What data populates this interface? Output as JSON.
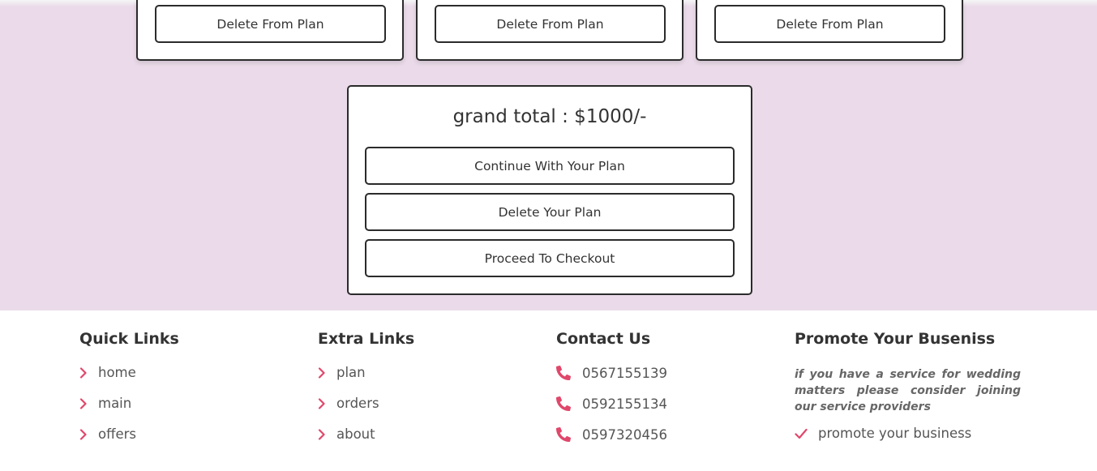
{
  "plan": {
    "cards": [
      {
        "delete_label": "Delete From Plan"
      },
      {
        "delete_label": "Delete From Plan"
      },
      {
        "delete_label": "Delete From Plan"
      }
    ],
    "grand_total": "grand total : $1000/-",
    "continue_label": "Continue With Your Plan",
    "delete_plan_label": "Delete Your Plan",
    "checkout_label": "Proceed To Checkout"
  },
  "footer": {
    "quick_links": {
      "title": "Quick Links",
      "items": [
        "home",
        "main",
        "offers"
      ]
    },
    "extra_links": {
      "title": "Extra Links",
      "items": [
        "plan",
        "orders",
        "about"
      ]
    },
    "contact": {
      "title": "Contact Us",
      "phones": [
        "0567155139",
        "0592155134",
        "0597320456"
      ]
    },
    "promote": {
      "title": "Promote Your Buseniss",
      "text": "if you have a service for wedding matters please consider joining our service providers",
      "link": "promote your business"
    }
  },
  "colors": {
    "plan_background": "#ebdbea",
    "accent": "#e0476b",
    "border": "#2b2b2b"
  },
  "icons": {
    "link": "chevron-right-icon",
    "phone": "phone-icon",
    "promote": "check-icon"
  }
}
